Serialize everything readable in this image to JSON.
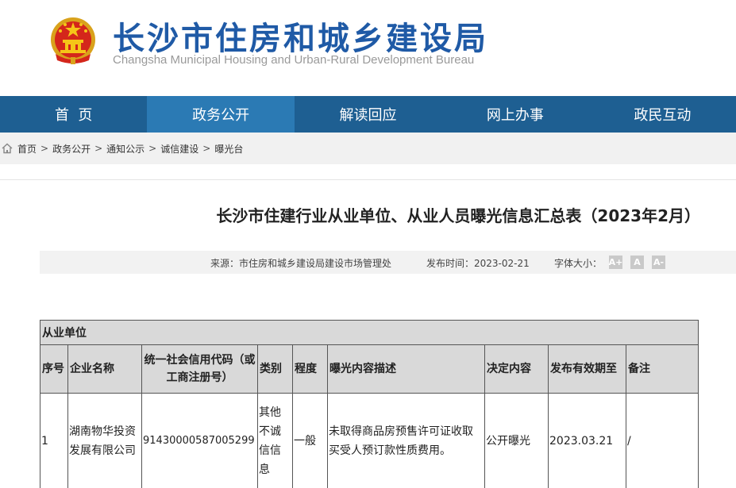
{
  "header": {
    "title": "长沙市住房和城乡建设局",
    "subtitle": "Changsha Municipal Housing and Urban-Rural Development Bureau",
    "emblem_icon": "national-emblem-icon"
  },
  "nav": {
    "items": [
      {
        "label": "首  页"
      },
      {
        "label": "政务公开"
      },
      {
        "label": "解读回应"
      },
      {
        "label": "网上办事"
      },
      {
        "label": "政民互动"
      }
    ],
    "active_index": 1
  },
  "breadcrumb": {
    "icon": "home-icon",
    "items": [
      "首页",
      "政务公开",
      "通知公示",
      "诚信建设",
      "曝光台"
    ],
    "separator": ">"
  },
  "article": {
    "title": "长沙市住建行业从业单位、从业人员曝光信息汇总表（2023年2月）",
    "source": "来源：市住房和城乡建设局建设市场管理处",
    "publish_time": "发布时间：2023-02-21",
    "font_size_label": "字体大小：",
    "font_buttons": [
      "A+",
      "A",
      "A-"
    ]
  },
  "table": {
    "section_title": "从业单位",
    "headers": [
      "序号",
      "企业名称",
      "统一社会信用代码（或工商注册号）",
      "类别",
      "程度",
      "曝光内容描述",
      "决定内容",
      "发布有效期至",
      "备注"
    ],
    "rows": [
      [
        "1",
        "湖南物华投资发展有限公司",
        "91430000587005299",
        "其他不诚信信息",
        "一般",
        "未取得商品房预售许可证收取买受人预订款性质费用。",
        "公开曝光",
        "2023.03.21",
        "/"
      ]
    ]
  },
  "colors": {
    "brand": "#1f5aa6",
    "nav_bg": "#1e5f92",
    "nav_active": "#2b7ab4",
    "table_header_bg": "#d9d9d9"
  }
}
